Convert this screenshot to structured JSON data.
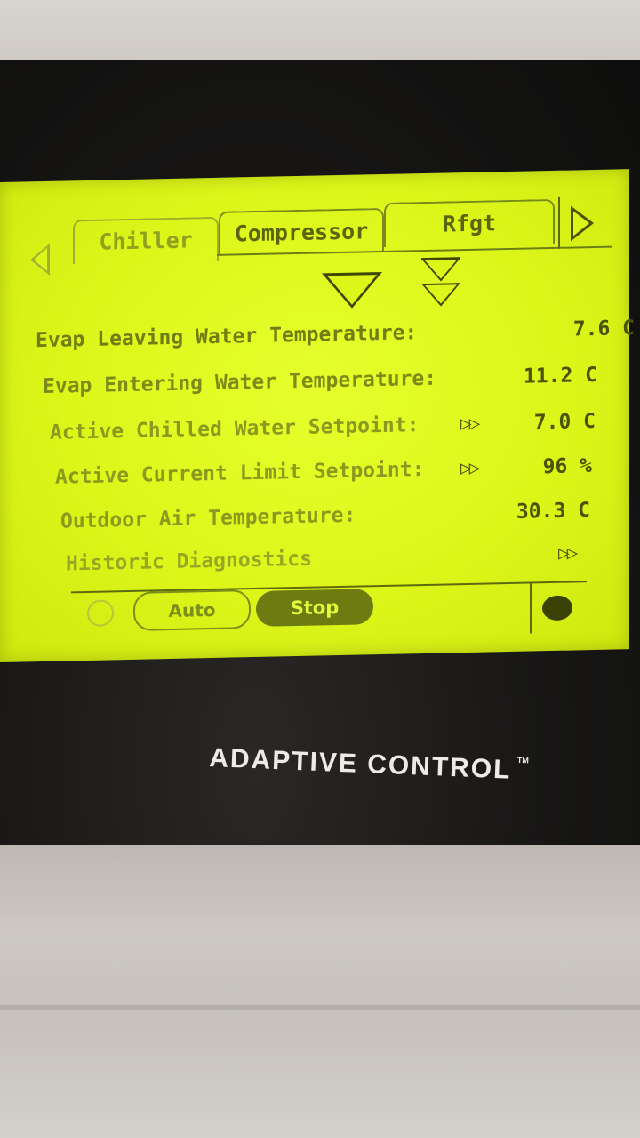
{
  "tabs": [
    "Chiller",
    "Compressor",
    "Rfgt"
  ],
  "rows": [
    {
      "label": "Evap Leaving Water Temperature:",
      "value": "7.6 C",
      "has_arrow": false
    },
    {
      "label": "Evap Entering Water Temperature:",
      "value": "11.2 C",
      "has_arrow": false
    },
    {
      "label": "Active Chilled Water Setpoint:",
      "value": "7.0 C",
      "has_arrow": true
    },
    {
      "label": "Active Current Limit Setpoint:",
      "value": "96 %",
      "has_arrow": true
    },
    {
      "label": "Outdoor Air Temperature:",
      "value": "30.3 C",
      "has_arrow": false
    },
    {
      "label": "Historic Diagnostics",
      "value": "",
      "has_arrow": true
    }
  ],
  "footer": {
    "auto_label": "Auto",
    "stop_label": "Stop"
  },
  "brand": {
    "name": "ADAPTIVE CONTROL",
    "trademark": "TM"
  },
  "colors": {
    "lcd_background": "#dcf61a",
    "lcd_text": "#3f4706",
    "bezel": "#171615"
  },
  "icons": {
    "nav_left": "triangle-left-outline",
    "nav_right": "triangle-right-outline",
    "scroll_down": "triangle-down-outline",
    "scroll_page_down": "double-triangle-down",
    "row_arrow": "double-triangle-right"
  }
}
